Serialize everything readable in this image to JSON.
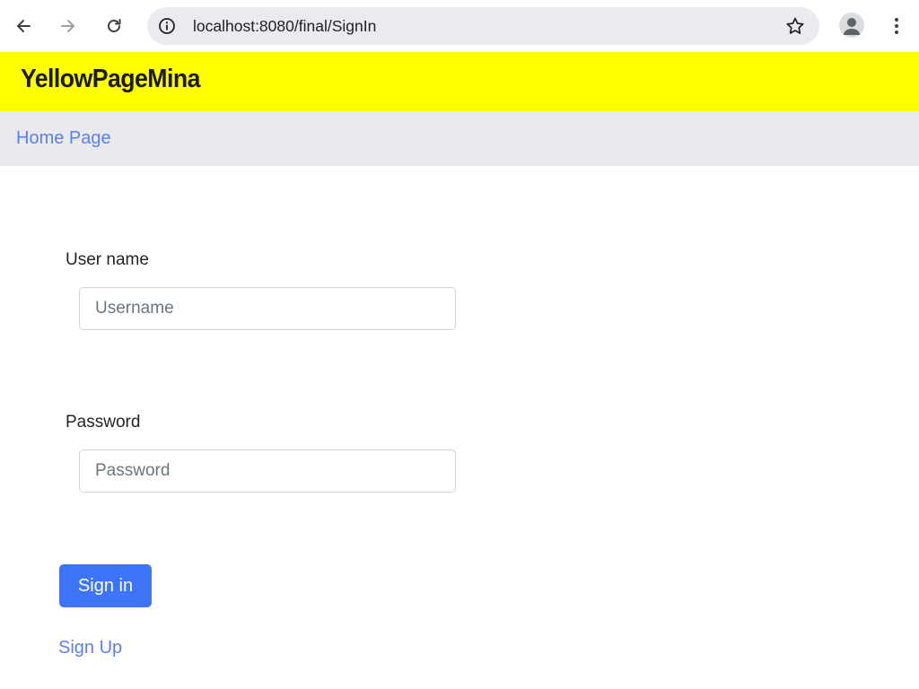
{
  "browser": {
    "url": "localhost:8080/final/SignIn",
    "icons": {
      "back": "back-arrow-icon",
      "forward": "forward-arrow-icon",
      "reload": "reload-icon",
      "info": "info-icon",
      "bookmark": "star-icon",
      "profile": "profile-icon",
      "menu": "kebab-menu-icon"
    }
  },
  "header": {
    "brand": "YellowPageMina",
    "background": "#ffff00"
  },
  "nav": {
    "home_label": "Home Page",
    "background": "#e8eaed",
    "link_color": "#5b7ff0"
  },
  "form": {
    "username_label": "User name",
    "username_placeholder": "Username",
    "username_value": "",
    "password_label": "Password",
    "password_placeholder": "Password",
    "password_value": "",
    "submit_label": "Sign in",
    "submit_color": "#3d74f8",
    "signup_label": "Sign Up"
  }
}
